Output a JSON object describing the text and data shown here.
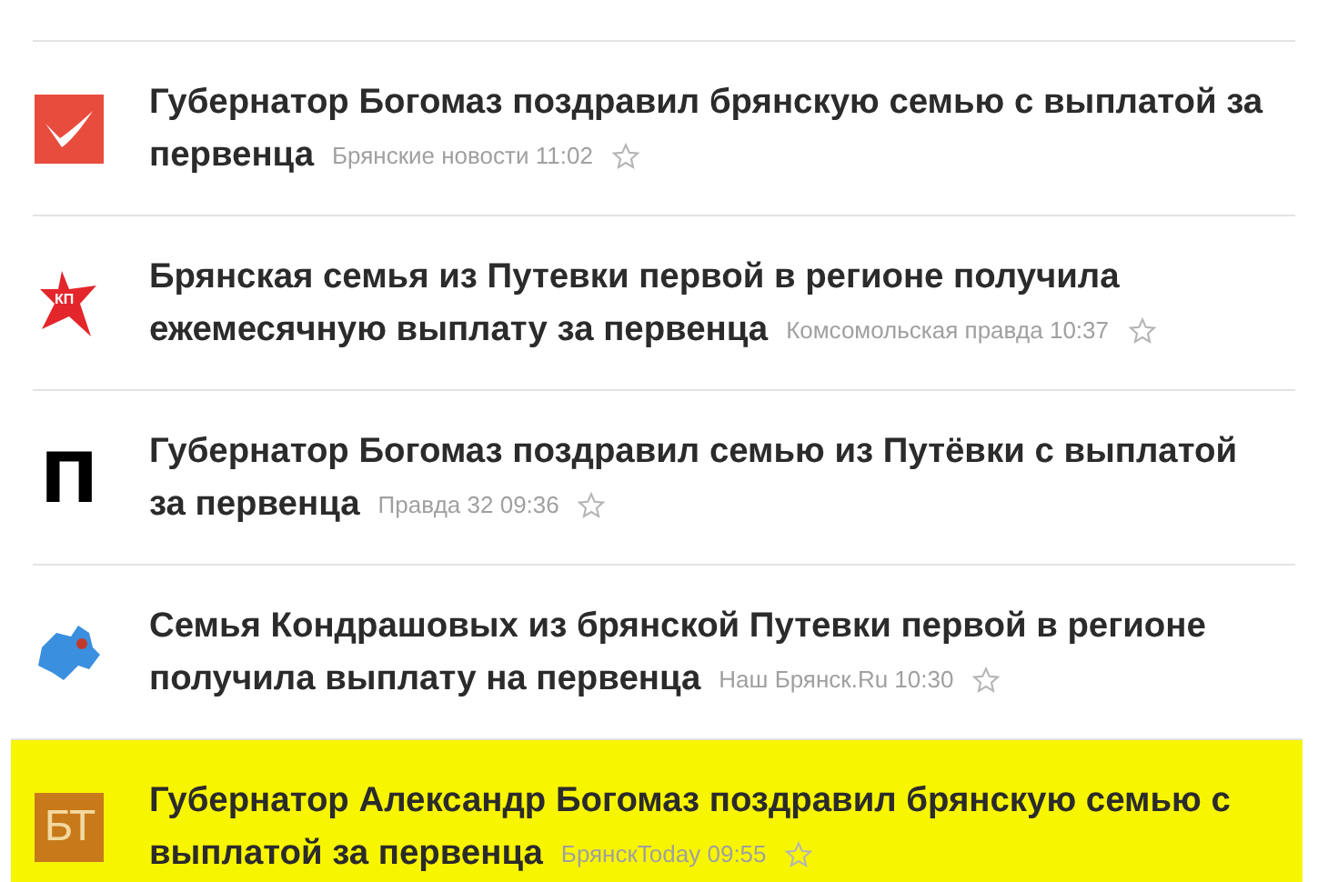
{
  "news": [
    {
      "logo": {
        "kind": "bird"
      },
      "title_lines": [
        "Губернатор Богомаз поздравил брянскую семью с выплатой за",
        "первенца"
      ],
      "source": "Брянские новости 11:02",
      "highlighted": false
    },
    {
      "logo": {
        "kind": "kp",
        "text": "КП"
      },
      "title_lines": [
        "Брянская семья из Путевки первой в регионе получила",
        "ежемесячную выплату за первенца"
      ],
      "source": "Комсомольская правда 10:37",
      "highlighted": false
    },
    {
      "logo": {
        "kind": "letter",
        "text": "П"
      },
      "title_lines": [
        "Губернатор Богомаз поздравил семью из Путёвки с выплатой",
        "за первенца"
      ],
      "source": "Правда 32 09:36",
      "highlighted": false
    },
    {
      "logo": {
        "kind": "map"
      },
      "title_lines": [
        "Семья Кондрашовых из брянской Путевки первой в регионе",
        "получила выплату на первенца"
      ],
      "source": "Наш Брянск.Ru 10:30",
      "highlighted": false
    },
    {
      "logo": {
        "kind": "box",
        "text": "БТ"
      },
      "title_lines": [
        "Губернатор Александр Богомаз поздравил брянскую семью с",
        "выплатой за первенца"
      ],
      "source": "БрянскToday 09:55",
      "highlighted": true
    }
  ]
}
